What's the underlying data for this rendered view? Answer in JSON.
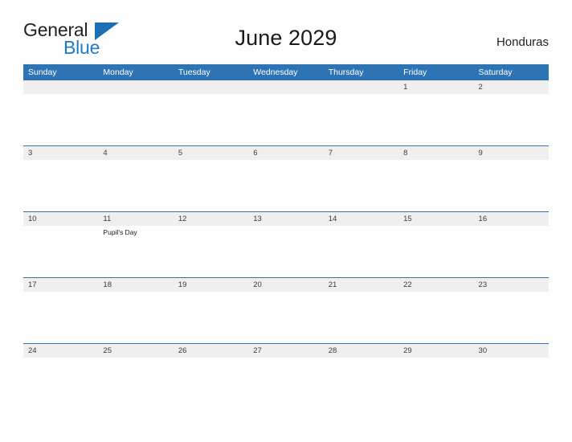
{
  "brand": {
    "word_one": "General",
    "word_two": "Blue",
    "flag_icon": "triangle-flag-icon",
    "accent_color": "#1a6fb5"
  },
  "header": {
    "title": "June 2029",
    "country": "Honduras"
  },
  "theme": {
    "header_blue": "#2e74b5",
    "date_band_gray": "#efefef",
    "page_background": "#fdfdfd",
    "text_color": "#1a1a1a"
  },
  "calendar": {
    "month": "June",
    "year": "2029",
    "weekday_headers": [
      "Sunday",
      "Monday",
      "Tuesday",
      "Wednesday",
      "Thursday",
      "Friday",
      "Saturday"
    ],
    "weeks": [
      [
        {
          "day": "",
          "events": []
        },
        {
          "day": "",
          "events": []
        },
        {
          "day": "",
          "events": []
        },
        {
          "day": "",
          "events": []
        },
        {
          "day": "",
          "events": []
        },
        {
          "day": "1",
          "events": []
        },
        {
          "day": "2",
          "events": []
        }
      ],
      [
        {
          "day": "3",
          "events": []
        },
        {
          "day": "4",
          "events": []
        },
        {
          "day": "5",
          "events": []
        },
        {
          "day": "6",
          "events": []
        },
        {
          "day": "7",
          "events": []
        },
        {
          "day": "8",
          "events": []
        },
        {
          "day": "9",
          "events": []
        }
      ],
      [
        {
          "day": "10",
          "events": []
        },
        {
          "day": "11",
          "events": [
            "Pupil's Day"
          ]
        },
        {
          "day": "12",
          "events": []
        },
        {
          "day": "13",
          "events": []
        },
        {
          "day": "14",
          "events": []
        },
        {
          "day": "15",
          "events": []
        },
        {
          "day": "16",
          "events": []
        }
      ],
      [
        {
          "day": "17",
          "events": []
        },
        {
          "day": "18",
          "events": []
        },
        {
          "day": "19",
          "events": []
        },
        {
          "day": "20",
          "events": []
        },
        {
          "day": "21",
          "events": []
        },
        {
          "day": "22",
          "events": []
        },
        {
          "day": "23",
          "events": []
        }
      ],
      [
        {
          "day": "24",
          "events": []
        },
        {
          "day": "25",
          "events": []
        },
        {
          "day": "26",
          "events": []
        },
        {
          "day": "27",
          "events": []
        },
        {
          "day": "28",
          "events": []
        },
        {
          "day": "29",
          "events": []
        },
        {
          "day": "30",
          "events": []
        }
      ]
    ]
  }
}
